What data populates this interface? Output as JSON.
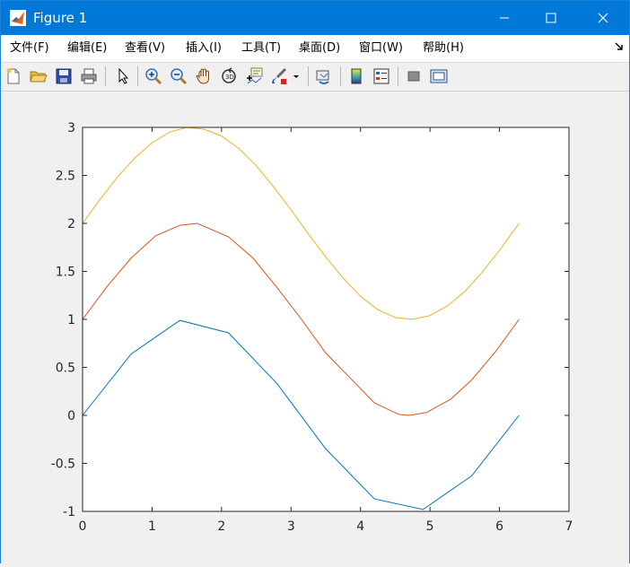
{
  "window": {
    "title": "Figure 1"
  },
  "menu": {
    "items": [
      "文件(F)",
      "编辑(E)",
      "查看(V)",
      "插入(I)",
      "工具(T)",
      "桌面(D)",
      "窗口(W)",
      "帮助(H)"
    ]
  },
  "toolbar": {
    "icons": [
      "new-figure-icon",
      "open-icon",
      "save-icon",
      "print-icon",
      "pointer-icon",
      "zoom-in-icon",
      "zoom-out-icon",
      "pan-icon",
      "rotate-3d-icon",
      "data-cursor-icon",
      "brush-icon",
      "brush-dropdown-icon",
      "link-plot-icon",
      "colorbar-icon",
      "legend-icon",
      "hide-plot-tools-icon",
      "show-plot-tools-icon"
    ]
  },
  "colors": {
    "titlebar": "#0078d7",
    "series_1": "#0072bd",
    "series_2": "#d95319",
    "series_3": "#edb120"
  },
  "chart_data": {
    "type": "line",
    "xlim": [
      0,
      7
    ],
    "ylim": [
      -1,
      3
    ],
    "xticks": [
      "0",
      "1",
      "2",
      "3",
      "4",
      "5",
      "6",
      "7"
    ],
    "yticks": [
      "-1",
      "-0.5",
      "0",
      "0.5",
      "1",
      "1.5",
      "2",
      "2.5",
      "3"
    ],
    "grid": false,
    "series": [
      {
        "color": "#0072bd",
        "x": [
          0,
          0.7,
          1.4,
          2.1,
          2.8,
          3.5,
          4.2,
          4.9,
          5.6,
          6.28
        ],
        "y": [
          0,
          0.64,
          0.99,
          0.86,
          0.33,
          -0.35,
          -0.87,
          -0.98,
          -0.63,
          0
        ]
      },
      {
        "color": "#d95319",
        "x": [
          0,
          0.35,
          0.7,
          1.05,
          1.4,
          1.65,
          2.1,
          2.45,
          2.8,
          3.15,
          3.5,
          4.2,
          4.55,
          4.7,
          4.95,
          5.3,
          5.6,
          5.95,
          6.28
        ],
        "y": [
          1,
          1.34,
          1.64,
          1.87,
          1.98,
          2.0,
          1.86,
          1.64,
          1.33,
          1.0,
          0.65,
          0.13,
          0.01,
          0.0,
          0.03,
          0.17,
          0.37,
          0.67,
          1.0
        ]
      },
      {
        "color": "#edb120",
        "x": [
          0,
          0.25,
          0.5,
          0.75,
          1.0,
          1.25,
          1.5,
          1.75,
          2.0,
          2.25,
          2.5,
          2.75,
          3.0,
          3.25,
          3.5,
          3.75,
          4.0,
          4.25,
          4.5,
          4.75,
          5.0,
          5.25,
          5.5,
          5.75,
          6.0,
          6.28
        ],
        "y": [
          2,
          2.25,
          2.48,
          2.68,
          2.84,
          2.95,
          3.0,
          2.98,
          2.91,
          2.78,
          2.6,
          2.38,
          2.14,
          1.89,
          1.65,
          1.43,
          1.24,
          1.1,
          1.02,
          1.0,
          1.04,
          1.14,
          1.29,
          1.49,
          1.72,
          2.0
        ]
      }
    ]
  }
}
